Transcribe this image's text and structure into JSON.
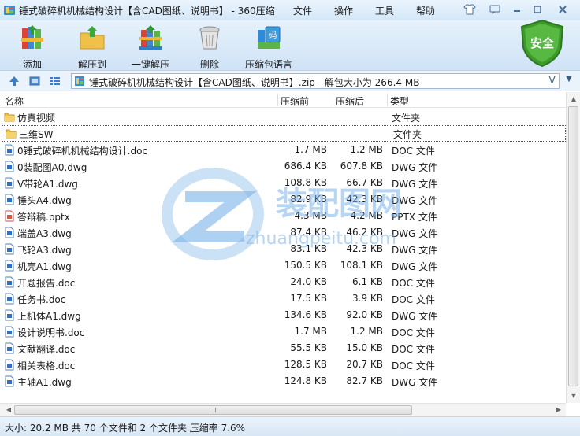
{
  "window": {
    "title": "锤式破碎机机械结构设计【含CAD图纸、说明书】 - 360压缩",
    "menus": [
      "文件",
      "操作",
      "工具",
      "帮助"
    ]
  },
  "toolbar": {
    "buttons": [
      {
        "label": "添加",
        "icon": "add-books-icon"
      },
      {
        "label": "解压到",
        "icon": "extract-folder-icon"
      },
      {
        "label": "一键解压",
        "icon": "one-click-extract-icon"
      },
      {
        "label": "删除",
        "icon": "trash-can-icon"
      },
      {
        "label": "压缩包语言",
        "icon": "archive-language-icon"
      }
    ],
    "security_label": "安全"
  },
  "address": {
    "path": "锤式破碎机机械结构设计【含CAD图纸、说明书】.zip - 解包大小为 266.4 MB"
  },
  "columns": {
    "name": "名称",
    "packed": "压缩前",
    "unpacked": "压缩后",
    "type": "类型"
  },
  "files": [
    {
      "name": "仿真视频",
      "packed": "",
      "unpacked": "",
      "type": "文件夹",
      "icon": "folder"
    },
    {
      "name": "三维SW",
      "packed": "",
      "unpacked": "",
      "type": "文件夹",
      "icon": "folder"
    },
    {
      "name": "0锤式破碎机机械结构设计.doc",
      "packed": "1.7 MB",
      "unpacked": "1.2 MB",
      "type": "DOC 文件",
      "icon": "doc"
    },
    {
      "name": "0装配图A0.dwg",
      "packed": "686.4 KB",
      "unpacked": "607.8 KB",
      "type": "DWG 文件",
      "icon": "dwg"
    },
    {
      "name": "V带轮A1.dwg",
      "packed": "108.8 KB",
      "unpacked": "66.7 KB",
      "type": "DWG 文件",
      "icon": "dwg"
    },
    {
      "name": "锤头A4.dwg",
      "packed": "82.9 KB",
      "unpacked": "42.3 KB",
      "type": "DWG 文件",
      "icon": "dwg"
    },
    {
      "name": "答辩稿.pptx",
      "packed": "4.3 MB",
      "unpacked": "4.2 MB",
      "type": "PPTX 文件",
      "icon": "pptx"
    },
    {
      "name": "端盖A3.dwg",
      "packed": "87.4 KB",
      "unpacked": "46.2 KB",
      "type": "DWG 文件",
      "icon": "dwg"
    },
    {
      "name": "飞轮A3.dwg",
      "packed": "83.1 KB",
      "unpacked": "42.3 KB",
      "type": "DWG 文件",
      "icon": "dwg"
    },
    {
      "name": "机壳A1.dwg",
      "packed": "150.5 KB",
      "unpacked": "108.1 KB",
      "type": "DWG 文件",
      "icon": "dwg"
    },
    {
      "name": "开题报告.doc",
      "packed": "24.0 KB",
      "unpacked": "6.1 KB",
      "type": "DOC 文件",
      "icon": "doc"
    },
    {
      "name": "任务书.doc",
      "packed": "17.5 KB",
      "unpacked": "3.9 KB",
      "type": "DOC 文件",
      "icon": "doc"
    },
    {
      "name": "上机体A1.dwg",
      "packed": "134.6 KB",
      "unpacked": "92.0 KB",
      "type": "DWG 文件",
      "icon": "dwg"
    },
    {
      "name": "设计说明书.doc",
      "packed": "1.7 MB",
      "unpacked": "1.2 MB",
      "type": "DOC 文件",
      "icon": "doc"
    },
    {
      "name": "文献翻译.doc",
      "packed": "55.5 KB",
      "unpacked": "15.0 KB",
      "type": "DOC 文件",
      "icon": "doc"
    },
    {
      "name": "相关表格.doc",
      "packed": "128.5 KB",
      "unpacked": "20.7 KB",
      "type": "DOC 文件",
      "icon": "doc"
    },
    {
      "name": "主轴A1.dwg",
      "packed": "124.8 KB",
      "unpacked": "82.7 KB",
      "type": "DWG 文件",
      "icon": "dwg"
    }
  ],
  "watermark": {
    "brand": "装配图网",
    "url": "zhuangpeitu.com"
  },
  "status": {
    "text": "大小: 20.2 MB 共 70 个文件和 2 个文件夹 压缩率 7.6%"
  },
  "colors": {
    "accent": "#2f7fc8",
    "security_green": "#3d9a2b",
    "folder": "#e8c050"
  }
}
